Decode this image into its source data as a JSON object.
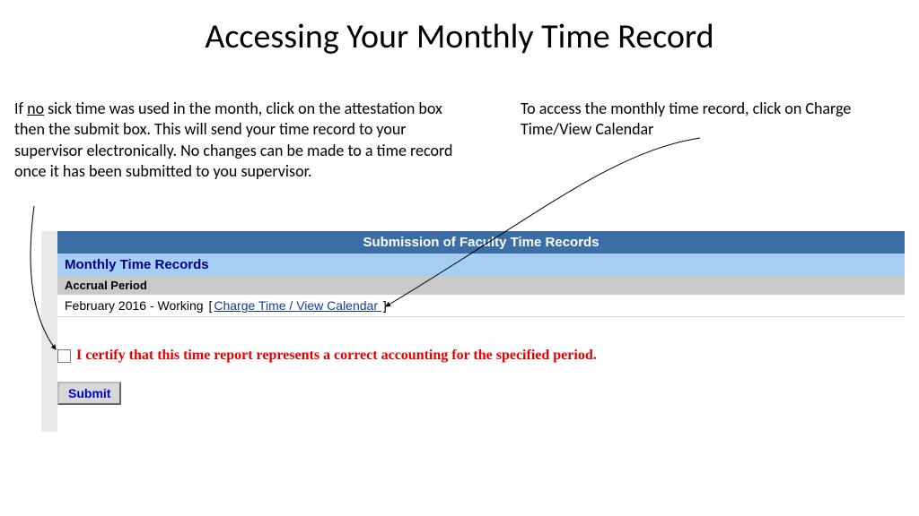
{
  "title": "Accessing Your Monthly Time Record",
  "instruction_left": {
    "pre": "If ",
    "underlined": "no",
    "post": " sick time was used in the month, click on the attestation box then the submit box.  This will send your time record to your supervisor electronically. No changes can be made to a time record once it has been submitted to you supervisor."
  },
  "instruction_right": "To access the monthly time record, click on Charge Time/View Calendar",
  "panel": {
    "header": "Submission of Faculty Time Records",
    "section": "Monthly Time Records",
    "sub": "Accrual Period",
    "period_text": "February 2016 - Working",
    "bracket_open": "[",
    "link": "Charge Time / View Calendar ",
    "bracket_close": "]"
  },
  "attest": {
    "text": "I certify that this time report represents a correct accounting for the specified period."
  },
  "submit": {
    "label": "Submit"
  }
}
